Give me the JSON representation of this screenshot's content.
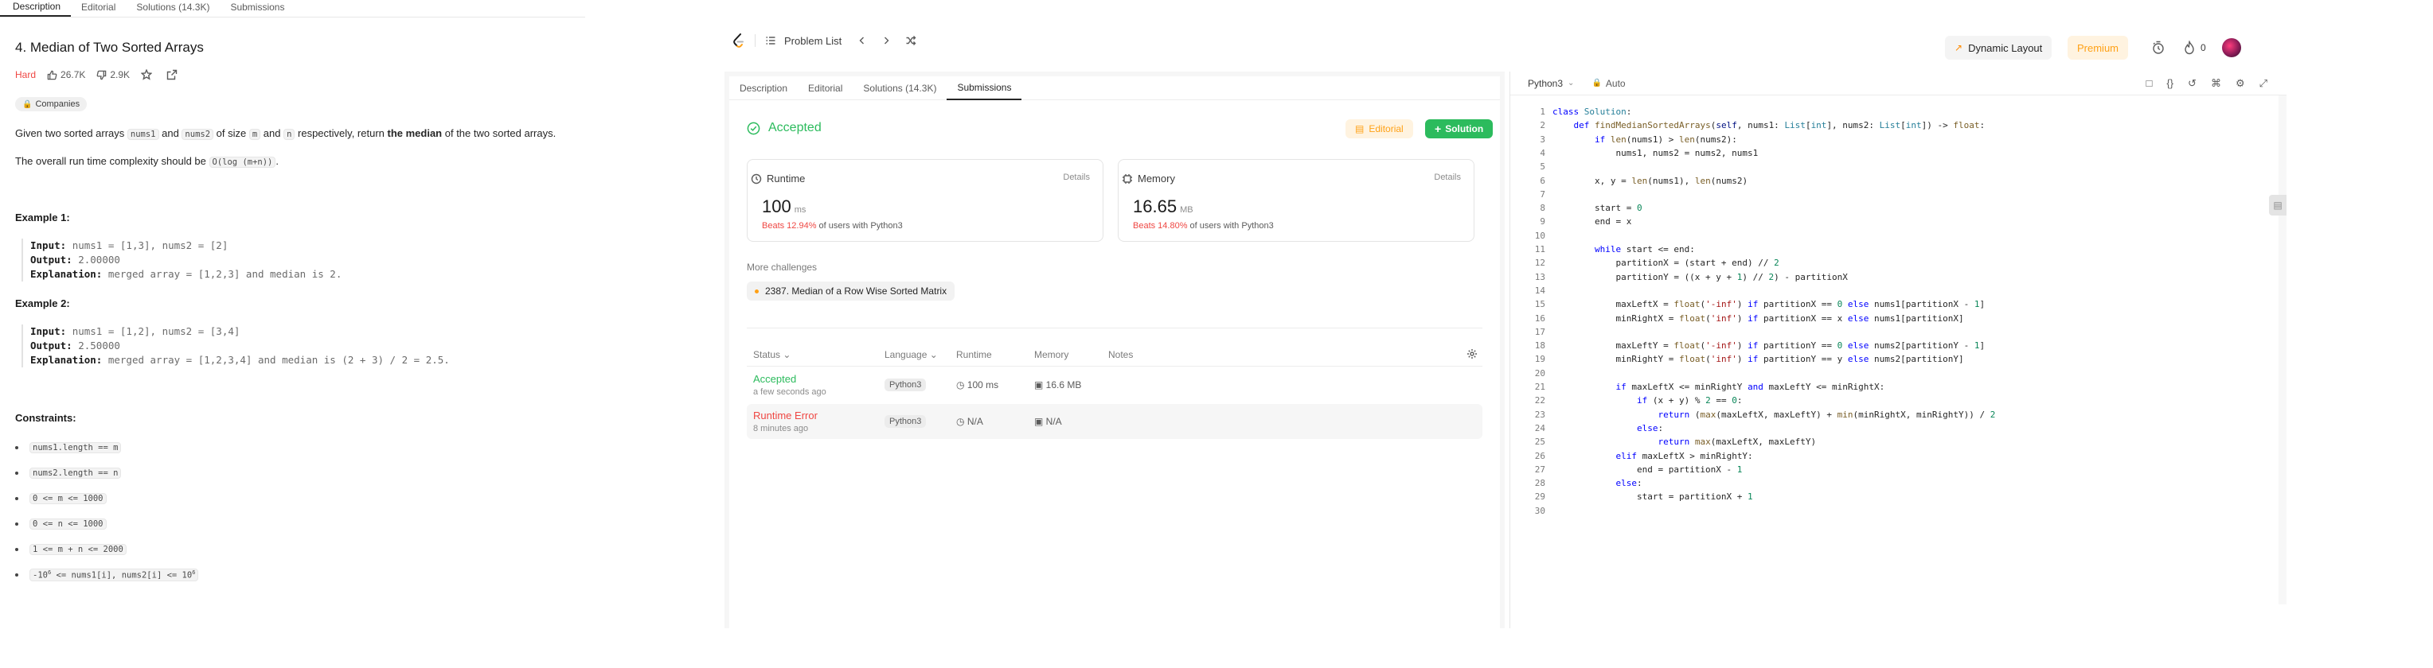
{
  "left": {
    "tabs": [
      "Description",
      "Editorial",
      "Solutions (14.3K)",
      "Submissions"
    ],
    "title": "4. Median of Two Sorted Arrays",
    "difficulty": "Hard",
    "likes": "26.7K",
    "dislikes": "2.9K",
    "companies_label": "Companies",
    "desc1": {
      "t1": "Given two sorted arrays ",
      "c1": "nums1",
      "t2": " and ",
      "c2": "nums2",
      "t3": " of size ",
      "c3": "m",
      "t4": " and ",
      "c4": "n",
      "t5": " respectively, return ",
      "bold": "the median",
      "t6": " of the two sorted arrays."
    },
    "desc2": {
      "t1": "The overall run time complexity should be ",
      "c1": "O(log (m+n))",
      "t2": "."
    },
    "examples": [
      {
        "heading": "Example 1:",
        "input_label": "Input:",
        "input": "nums1 = [1,3], nums2 = [2]",
        "output_label": "Output:",
        "output": "2.00000",
        "expl_label": "Explanation:",
        "explanation": "merged array = [1,2,3] and median is 2."
      },
      {
        "heading": "Example 2:",
        "input_label": "Input:",
        "input": "nums1 = [1,2], nums2 = [3,4]",
        "output_label": "Output:",
        "output": "2.50000",
        "expl_label": "Explanation:",
        "explanation": "merged array = [1,2,3,4] and median is (2 + 3) / 2 = 2.5."
      }
    ],
    "constraints_heading": "Constraints:",
    "constraints": [
      "nums1.length == m",
      "nums2.length == n",
      "0 <= m <= 1000",
      "0 <= n <= 1000",
      "1 <= m + n <= 2000"
    ],
    "last_constraint": {
      "a": "-10",
      "b": "6",
      "c": " <= nums1[i], nums2[i] <= 10",
      "d": "6"
    }
  },
  "header": {
    "problem_list": "Problem List",
    "dynamic_layout": "Dynamic Layout",
    "premium": "Premium",
    "streak": "0"
  },
  "submission": {
    "tabs": [
      "Description",
      "Editorial",
      "Solutions (14.3K)",
      "Submissions"
    ],
    "status": "Accepted",
    "editorial_btn": "Editorial",
    "solution_btn": "Solution",
    "runtime": {
      "label": "Runtime",
      "details": "Details",
      "value": "100",
      "unit": "ms",
      "beats": "Beats 12.94%",
      "suffix": " of users with Python3"
    },
    "memory": {
      "label": "Memory",
      "details": "Details",
      "value": "16.65",
      "unit": "MB",
      "beats": "Beats 14.80%",
      "suffix": " of users with Python3"
    },
    "more_challenges": "More challenges",
    "challenge": "2387. Median of a Row Wise Sorted Matrix",
    "columns": [
      "Status",
      "Language",
      "Runtime",
      "Memory",
      "Notes"
    ],
    "rows": [
      {
        "status": "Accepted",
        "time": "a few seconds ago",
        "lang": "Python3",
        "runtime": "100 ms",
        "memory": "16.6 MB"
      },
      {
        "status": "Runtime Error",
        "time": "8 minutes ago",
        "lang": "Python3",
        "runtime": "N/A",
        "memory": "N/A"
      }
    ],
    "colors": {
      "accepted": "#2cbb5d",
      "error": "#ef4743"
    }
  },
  "editor": {
    "language": "Python3",
    "auto": "Auto",
    "line_numbers": [
      "1",
      "2",
      "3",
      "4",
      "5",
      "6",
      "7",
      "8",
      "9",
      "10",
      "11",
      "12",
      "13",
      "14",
      "15",
      "16",
      "17",
      "18",
      "19",
      "20",
      "21",
      "22",
      "23",
      "24",
      "25",
      "26",
      "27",
      "28",
      "29",
      "30"
    ],
    "code": [
      "class Solution:",
      "    def findMedianSortedArrays(self, nums1: List[int], nums2: List[int]) -> float:",
      "        if len(nums1) > len(nums2):",
      "            nums1, nums2 = nums2, nums1",
      "",
      "        x, y = len(nums1), len(nums2)",
      "",
      "        start = 0",
      "        end = x",
      "",
      "        while start <= end:",
      "            partitionX = (start + end) // 2",
      "            partitionY = ((x + y + 1) // 2) - partitionX",
      "",
      "            maxLeftX = float('-inf') if partitionX == 0 else nums1[partitionX - 1]",
      "            minRightX = float('inf') if partitionX == x else nums1[partitionX]",
      "",
      "            maxLeftY = float('-inf') if partitionY == 0 else nums2[partitionY - 1]",
      "            minRightY = float('inf') if partitionY == y else nums2[partitionY]",
      "",
      "            if maxLeftX <= minRightY and maxLeftY <= minRightX:",
      "                if (x + y) % 2 == 0:",
      "                    return (max(maxLeftX, maxLeftY) + min(minRightX, minRightY)) / 2",
      "                else:",
      "                    return max(maxLeftX, maxLeftY)",
      "            elif maxLeftX > minRightY:",
      "                end = partitionX - 1",
      "            else:",
      "                start = partitionX + 1",
      ""
    ]
  }
}
